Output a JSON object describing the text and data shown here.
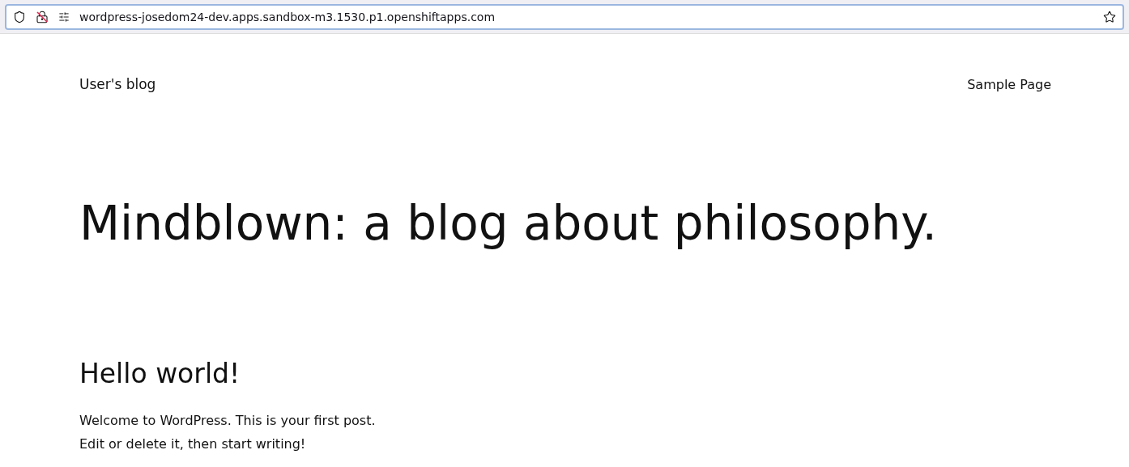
{
  "address_bar": {
    "value": "wordpress-josedom24-dev.apps.sandbox-m3.1530.p1.openshiftapps.com"
  },
  "site": {
    "title": "User's blog",
    "nav": [
      {
        "label": "Sample Page"
      }
    ]
  },
  "hero": {
    "heading": "Mindblown: a blog about philosophy."
  },
  "posts": [
    {
      "title": "Hello world!",
      "lines": [
        "Welcome to WordPress. This is your first post.",
        "Edit or delete it, then start writing!"
      ]
    }
  ]
}
